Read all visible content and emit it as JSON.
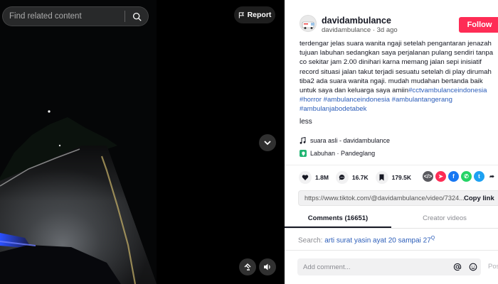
{
  "video": {
    "search_placeholder": "Find related content",
    "report_label": "Report"
  },
  "author": {
    "username": "davidambulance",
    "subline": "davidambulance · 3d ago",
    "follow_label": "Follow"
  },
  "description": {
    "lines": [
      "terdengar jelas suara wanita ngaji setelah pengantaran jenazah",
      "tujuan labuhan sedangkan saya perjalanan pulang sendiri tanpa",
      "co sekitar jam 2.00 dinihari karna memang jalan sepi inisiatif",
      "record situasi jalan takut terjadi sesuatu setelah di play dirumah",
      "tiba2 ada suara wanita ngaji. mudah mudahan bertanda baik",
      "untuk saya dan keluarga saya amiin"
    ],
    "hashtags": [
      "#cctvambulanceindonesia",
      "#horror",
      "#ambulanceindonesia",
      "#ambulantangerang",
      "#ambulanjabodetabek"
    ],
    "less_label": "less"
  },
  "sound": "suara asli - davidambulance",
  "location": "Labuhan · Pandeglang",
  "stats": {
    "likes": "1.8M",
    "comments": "16.7K",
    "saves": "179.5K"
  },
  "share": {
    "link": "https://www.tiktok.com/@davidambulance/video/7324...",
    "copy_label": "Copy link"
  },
  "tabs": [
    {
      "label": "Comments (16651)",
      "active": true
    },
    {
      "label": "Creator videos",
      "active": false
    }
  ],
  "related_search": {
    "prefix": "Search:",
    "query": "arti surat yasin ayat 20 sampai 27"
  },
  "comment_input": {
    "placeholder": "Add comment...",
    "post_label": "Post"
  },
  "colors": {
    "follow": "#fe2c55",
    "hashtag": "#2b5db9"
  }
}
